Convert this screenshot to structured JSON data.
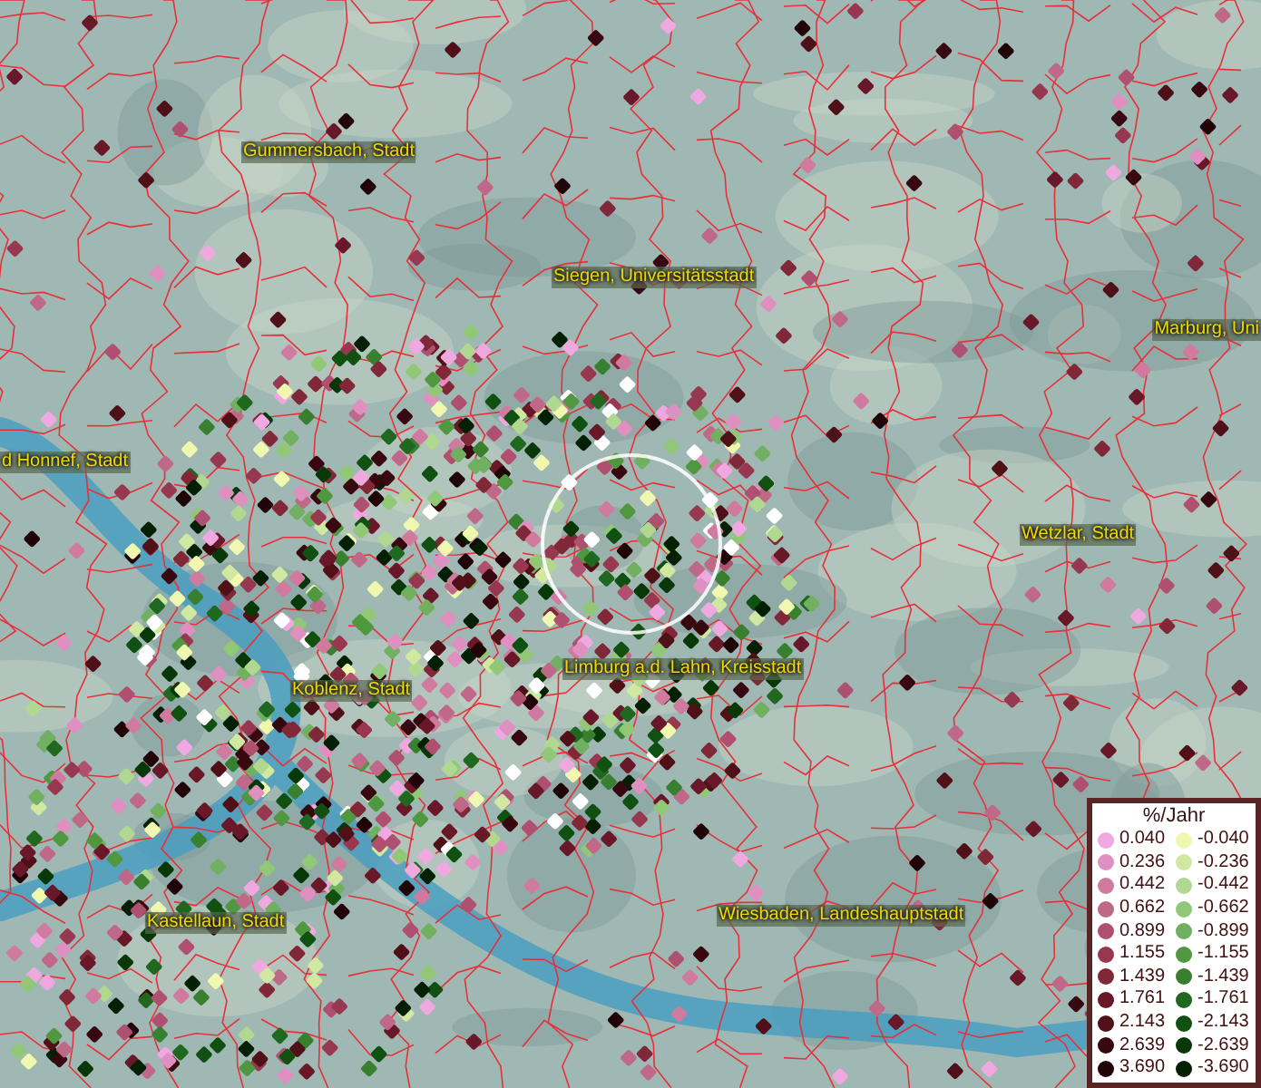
{
  "map": {
    "city_labels": [
      {
        "text": "Gummersbach, Stadt"
      },
      {
        "text": "Siegen, Universitätsstadt"
      },
      {
        "text": "Marburg, Uni"
      },
      {
        "text": "d Honnef, Stadt"
      },
      {
        "text": "Wetzlar, Stadt"
      },
      {
        "text": "Limburg a.d. Lahn, Kreisstadt"
      },
      {
        "text": "Koblenz, Stadt"
      },
      {
        "text": "Kastellaun, Stadt"
      },
      {
        "text": "Wiesbaden, Landeshauptstadt"
      }
    ]
  },
  "legend": {
    "title": "%/Jahr",
    "positive": [
      {
        "value": "0.040",
        "color": "#f0a8e0"
      },
      {
        "value": "0.236",
        "color": "#e090c0"
      },
      {
        "value": "0.442",
        "color": "#d07aa0"
      },
      {
        "value": "0.662",
        "color": "#c06888"
      },
      {
        "value": "0.899",
        "color": "#b05070"
      },
      {
        "value": "1.155",
        "color": "#983850"
      },
      {
        "value": "1.439",
        "color": "#802838"
      },
      {
        "value": "1.761",
        "color": "#681828"
      },
      {
        "value": "2.143",
        "color": "#501018"
      },
      {
        "value": "2.639",
        "color": "#380810"
      },
      {
        "value": "3.690",
        "color": "#200408"
      }
    ],
    "negative": [
      {
        "value": "-0.040",
        "color": "#f0f8b0"
      },
      {
        "value": "-0.236",
        "color": "#d0e8a0"
      },
      {
        "value": "-0.442",
        "color": "#b0d890"
      },
      {
        "value": "-0.662",
        "color": "#90c878"
      },
      {
        "value": "-0.899",
        "color": "#70b060"
      },
      {
        "value": "-1.155",
        "color": "#509840"
      },
      {
        "value": "-1.439",
        "color": "#388030"
      },
      {
        "value": "-1.761",
        "color": "#206820"
      },
      {
        "value": "-2.143",
        "color": "#105010"
      },
      {
        "value": "-2.639",
        "color": "#083808"
      },
      {
        "value": "-3.690",
        "color": "#042004"
      }
    ]
  }
}
